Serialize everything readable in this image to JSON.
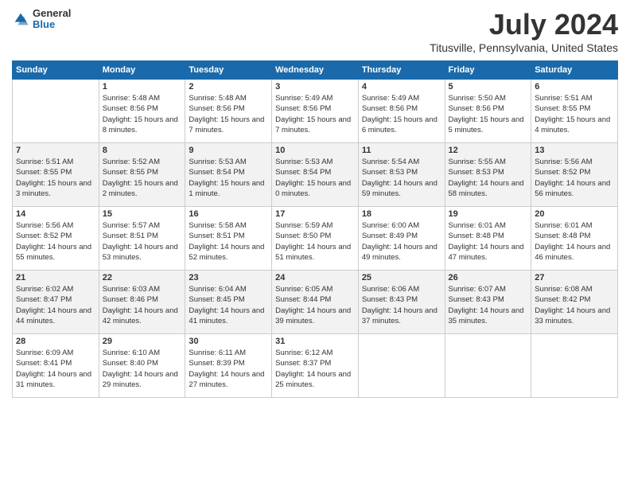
{
  "header": {
    "logo": {
      "general": "General",
      "blue": "Blue"
    },
    "month": "July 2024",
    "location": "Titusville, Pennsylvania, United States"
  },
  "weekdays": [
    "Sunday",
    "Monday",
    "Tuesday",
    "Wednesday",
    "Thursday",
    "Friday",
    "Saturday"
  ],
  "weeks": [
    [
      {
        "day": "",
        "empty": true
      },
      {
        "day": "1",
        "sunrise": "Sunrise: 5:48 AM",
        "sunset": "Sunset: 8:56 PM",
        "daylight": "Daylight: 15 hours and 8 minutes."
      },
      {
        "day": "2",
        "sunrise": "Sunrise: 5:48 AM",
        "sunset": "Sunset: 8:56 PM",
        "daylight": "Daylight: 15 hours and 7 minutes."
      },
      {
        "day": "3",
        "sunrise": "Sunrise: 5:49 AM",
        "sunset": "Sunset: 8:56 PM",
        "daylight": "Daylight: 15 hours and 7 minutes."
      },
      {
        "day": "4",
        "sunrise": "Sunrise: 5:49 AM",
        "sunset": "Sunset: 8:56 PM",
        "daylight": "Daylight: 15 hours and 6 minutes."
      },
      {
        "day": "5",
        "sunrise": "Sunrise: 5:50 AM",
        "sunset": "Sunset: 8:56 PM",
        "daylight": "Daylight: 15 hours and 5 minutes."
      },
      {
        "day": "6",
        "sunrise": "Sunrise: 5:51 AM",
        "sunset": "Sunset: 8:55 PM",
        "daylight": "Daylight: 15 hours and 4 minutes."
      }
    ],
    [
      {
        "day": "7",
        "sunrise": "Sunrise: 5:51 AM",
        "sunset": "Sunset: 8:55 PM",
        "daylight": "Daylight: 15 hours and 3 minutes."
      },
      {
        "day": "8",
        "sunrise": "Sunrise: 5:52 AM",
        "sunset": "Sunset: 8:55 PM",
        "daylight": "Daylight: 15 hours and 2 minutes."
      },
      {
        "day": "9",
        "sunrise": "Sunrise: 5:53 AM",
        "sunset": "Sunset: 8:54 PM",
        "daylight": "Daylight: 15 hours and 1 minute."
      },
      {
        "day": "10",
        "sunrise": "Sunrise: 5:53 AM",
        "sunset": "Sunset: 8:54 PM",
        "daylight": "Daylight: 15 hours and 0 minutes."
      },
      {
        "day": "11",
        "sunrise": "Sunrise: 5:54 AM",
        "sunset": "Sunset: 8:53 PM",
        "daylight": "Daylight: 14 hours and 59 minutes."
      },
      {
        "day": "12",
        "sunrise": "Sunrise: 5:55 AM",
        "sunset": "Sunset: 8:53 PM",
        "daylight": "Daylight: 14 hours and 58 minutes."
      },
      {
        "day": "13",
        "sunrise": "Sunrise: 5:56 AM",
        "sunset": "Sunset: 8:52 PM",
        "daylight": "Daylight: 14 hours and 56 minutes."
      }
    ],
    [
      {
        "day": "14",
        "sunrise": "Sunrise: 5:56 AM",
        "sunset": "Sunset: 8:52 PM",
        "daylight": "Daylight: 14 hours and 55 minutes."
      },
      {
        "day": "15",
        "sunrise": "Sunrise: 5:57 AM",
        "sunset": "Sunset: 8:51 PM",
        "daylight": "Daylight: 14 hours and 53 minutes."
      },
      {
        "day": "16",
        "sunrise": "Sunrise: 5:58 AM",
        "sunset": "Sunset: 8:51 PM",
        "daylight": "Daylight: 14 hours and 52 minutes."
      },
      {
        "day": "17",
        "sunrise": "Sunrise: 5:59 AM",
        "sunset": "Sunset: 8:50 PM",
        "daylight": "Daylight: 14 hours and 51 minutes."
      },
      {
        "day": "18",
        "sunrise": "Sunrise: 6:00 AM",
        "sunset": "Sunset: 8:49 PM",
        "daylight": "Daylight: 14 hours and 49 minutes."
      },
      {
        "day": "19",
        "sunrise": "Sunrise: 6:01 AM",
        "sunset": "Sunset: 8:48 PM",
        "daylight": "Daylight: 14 hours and 47 minutes."
      },
      {
        "day": "20",
        "sunrise": "Sunrise: 6:01 AM",
        "sunset": "Sunset: 8:48 PM",
        "daylight": "Daylight: 14 hours and 46 minutes."
      }
    ],
    [
      {
        "day": "21",
        "sunrise": "Sunrise: 6:02 AM",
        "sunset": "Sunset: 8:47 PM",
        "daylight": "Daylight: 14 hours and 44 minutes."
      },
      {
        "day": "22",
        "sunrise": "Sunrise: 6:03 AM",
        "sunset": "Sunset: 8:46 PM",
        "daylight": "Daylight: 14 hours and 42 minutes."
      },
      {
        "day": "23",
        "sunrise": "Sunrise: 6:04 AM",
        "sunset": "Sunset: 8:45 PM",
        "daylight": "Daylight: 14 hours and 41 minutes."
      },
      {
        "day": "24",
        "sunrise": "Sunrise: 6:05 AM",
        "sunset": "Sunset: 8:44 PM",
        "daylight": "Daylight: 14 hours and 39 minutes."
      },
      {
        "day": "25",
        "sunrise": "Sunrise: 6:06 AM",
        "sunset": "Sunset: 8:43 PM",
        "daylight": "Daylight: 14 hours and 37 minutes."
      },
      {
        "day": "26",
        "sunrise": "Sunrise: 6:07 AM",
        "sunset": "Sunset: 8:43 PM",
        "daylight": "Daylight: 14 hours and 35 minutes."
      },
      {
        "day": "27",
        "sunrise": "Sunrise: 6:08 AM",
        "sunset": "Sunset: 8:42 PM",
        "daylight": "Daylight: 14 hours and 33 minutes."
      }
    ],
    [
      {
        "day": "28",
        "sunrise": "Sunrise: 6:09 AM",
        "sunset": "Sunset: 8:41 PM",
        "daylight": "Daylight: 14 hours and 31 minutes."
      },
      {
        "day": "29",
        "sunrise": "Sunrise: 6:10 AM",
        "sunset": "Sunset: 8:40 PM",
        "daylight": "Daylight: 14 hours and 29 minutes."
      },
      {
        "day": "30",
        "sunrise": "Sunrise: 6:11 AM",
        "sunset": "Sunset: 8:39 PM",
        "daylight": "Daylight: 14 hours and 27 minutes."
      },
      {
        "day": "31",
        "sunrise": "Sunrise: 6:12 AM",
        "sunset": "Sunset: 8:37 PM",
        "daylight": "Daylight: 14 hours and 25 minutes."
      },
      {
        "day": "",
        "empty": true
      },
      {
        "day": "",
        "empty": true
      },
      {
        "day": "",
        "empty": true
      }
    ]
  ]
}
